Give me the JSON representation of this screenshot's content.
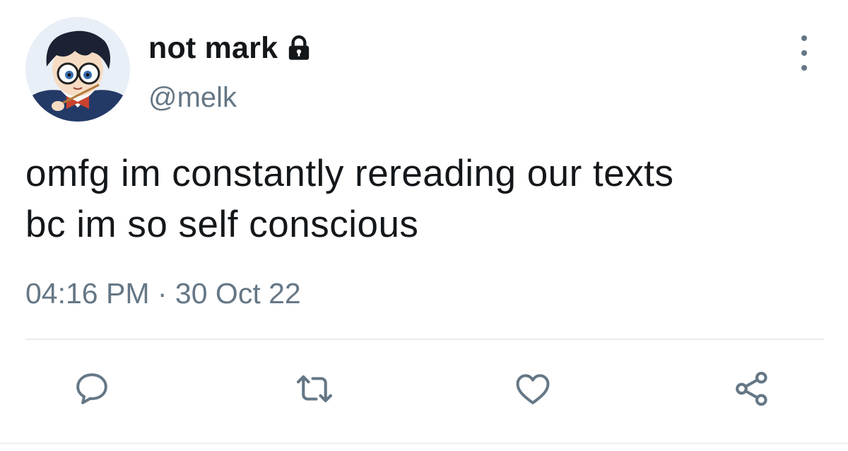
{
  "author": {
    "display_name": "not mark",
    "handle": "@melk",
    "avatar": "cartoon-boy-with-glasses-avatar",
    "protected_icon": "lock-icon"
  },
  "tweet": {
    "text_lines": [
      "omfg im constantly rereading our texts",
      "bc im so self conscious"
    ],
    "timestamp": "04:16 PM · 30 Oct 22"
  },
  "actions": [
    {
      "name": "reply",
      "icon": "speech-bubble-icon"
    },
    {
      "name": "retweet",
      "icon": "retweet-arrows-icon"
    },
    {
      "name": "like",
      "icon": "heart-icon"
    },
    {
      "name": "share",
      "icon": "share-nodes-icon"
    }
  ],
  "menu": {
    "icon": "vertical-ellipsis-icon"
  },
  "colors": {
    "text_primary": "#14171a",
    "text_secondary": "#657786",
    "divider": "#e6ecf0"
  }
}
